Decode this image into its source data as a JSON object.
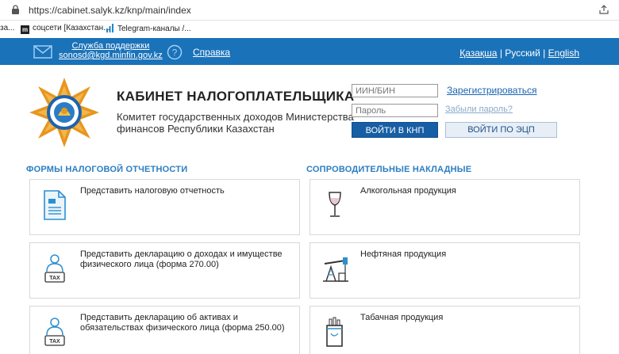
{
  "browser": {
    "url": "https://cabinet.salyk.kz/knp/main/index",
    "bookmarks": [
      "за...",
      "соцсети [Казахстан...",
      "Telegram-каналы /..."
    ]
  },
  "topbar": {
    "support_label": "Служба поддержки",
    "support_email": "sonosd@kgd.minfin.gov.kz",
    "help_label": "Справка",
    "lang_kz": "Қазақша",
    "lang_ru": "Русский",
    "lang_en": "English",
    "separator": "|"
  },
  "header": {
    "title": "КАБИНЕТ НАЛОГОПЛАТЕЛЬЩИКА",
    "subtitle": "Комитет государственных доходов Министерства финансов Республики Казахстан"
  },
  "login": {
    "iin_placeholder": "ИИН/БИН",
    "password_placeholder": "Пароль",
    "register_label": "Зарегистрироваться",
    "forgot_label": "Забыли пароль?",
    "login_knp_label": "ВОЙТИ В КНП",
    "login_ecp_label": "ВОЙТИ ПО ЭЦП"
  },
  "sections": {
    "left_title": "ФОРМЫ НАЛОГОВОЙ ОТЧЕТНОСТИ",
    "right_title": "СОПРОВОДИТЕЛЬНЫЕ НАКЛАДНЫЕ",
    "left_items": [
      {
        "label": "Представить налоговую отчетность",
        "icon": "document-icon"
      },
      {
        "label": "Представить декларацию о доходах и имуществе физического лица (форма 270.00)",
        "icon": "tax-person-icon"
      },
      {
        "label": "Представить декларацию об активах и обязательствах физического лица (форма 250.00)",
        "icon": "tax-person-icon"
      }
    ],
    "right_items": [
      {
        "label": "Алкогольная продукция",
        "icon": "wine-glass-icon"
      },
      {
        "label": "Нефтяная продукция",
        "icon": "oil-pump-icon"
      },
      {
        "label": "Табачная продукция",
        "icon": "cigarette-pack-icon"
      }
    ],
    "tax_badge": "TAX"
  },
  "colors": {
    "brand_blue": "#1a72b9",
    "button_blue": "#175ea4",
    "section_title": "#2b7ec1"
  }
}
